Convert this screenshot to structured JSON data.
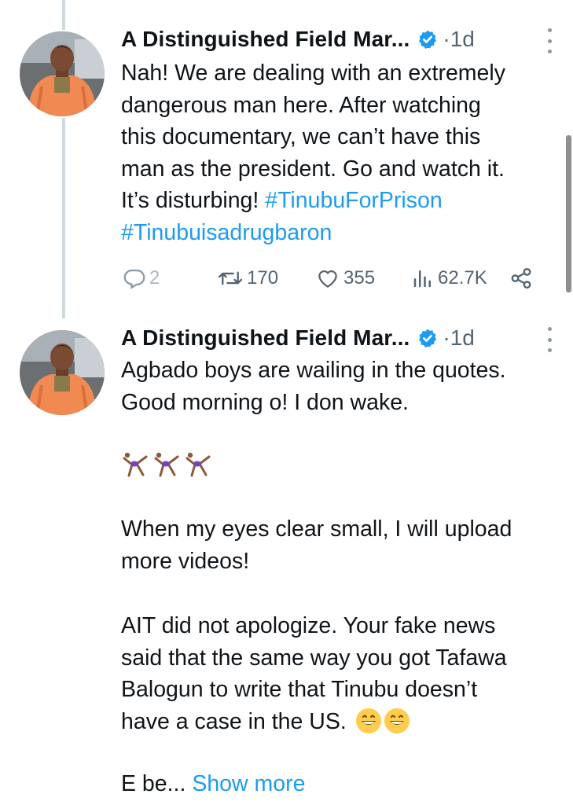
{
  "tweets": [
    {
      "author": "A Distinguished Field Mar...",
      "separator": "·",
      "time": "1d",
      "text_plain": "Nah! We are dealing with an extremely\ndangerous man here. After watching\nthis documentary, we can’t have this\nman as the president. Go and watch it.\nIt’s disturbing! ",
      "hashtags": [
        "#TinubuForPrison",
        "#Tinubuisadrugbaron"
      ],
      "stats": {
        "replies": "2",
        "retweets": "170",
        "likes": "355",
        "views": "62.7K"
      }
    },
    {
      "author": "A Distinguished Field Mar...",
      "separator": "·",
      "time": "1d",
      "para1": "Agbado boys are wailing in the quotes.\nGood morning o! I don wake.",
      "emoji_count": 3,
      "para2": "When my eyes clear small, I will upload\nmore videos!",
      "para3": "AIT did not apologize. Your fake news\nsaid that the same way you got Tafawa\nBalogun to write that Tinubu doesn’t\nhave a case in the US. ",
      "para4_prefix": "E be...",
      "show_more": "Show more"
    }
  ],
  "icons": {
    "verified": "verified-badge-icon",
    "reply": "reply-icon",
    "retweet": "retweet-icon",
    "like": "heart-icon",
    "views": "views-icon",
    "share": "share-icon",
    "more": "more-options-icon"
  },
  "colors": {
    "accent": "#1d9bf0",
    "muted": "#536471",
    "avatar_coat": "#f08a52"
  }
}
